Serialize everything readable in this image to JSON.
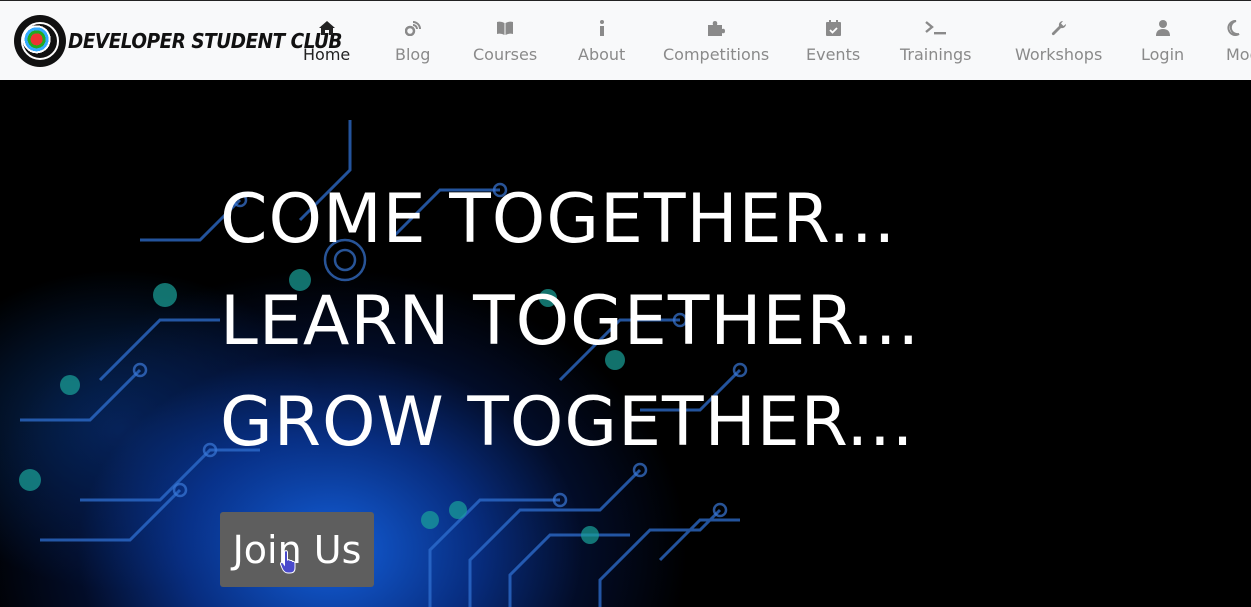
{
  "brand": {
    "name": "DEVELOPER STUDENT CLUB"
  },
  "nav": {
    "items": [
      {
        "label": "Home",
        "icon": "home-icon"
      },
      {
        "label": "Blog",
        "icon": "blog-icon"
      },
      {
        "label": "Courses",
        "icon": "book-icon"
      },
      {
        "label": "About",
        "icon": "info-icon"
      },
      {
        "label": "Competitions",
        "icon": "puzzle-icon"
      },
      {
        "label": "Events",
        "icon": "calendar-icon"
      },
      {
        "label": "Trainings",
        "icon": "terminal-icon"
      },
      {
        "label": "Workshops",
        "icon": "wrench-icon"
      },
      {
        "label": "Login",
        "icon": "user-icon"
      },
      {
        "label": "Mode",
        "icon": "moon-icon"
      }
    ],
    "active": "Home"
  },
  "hero": {
    "lines": [
      "COME TOGETHER...",
      "LEARN TOGETHER...",
      "GROW TOGETHER..."
    ],
    "cta_label": "Join Us"
  },
  "colors": {
    "nav_bg": "#f8f9fa",
    "nav_text": "#8a8a8a",
    "nav_active": "#222222",
    "hero_bg": "#000000",
    "cta_bg": "#5e5e5e"
  }
}
